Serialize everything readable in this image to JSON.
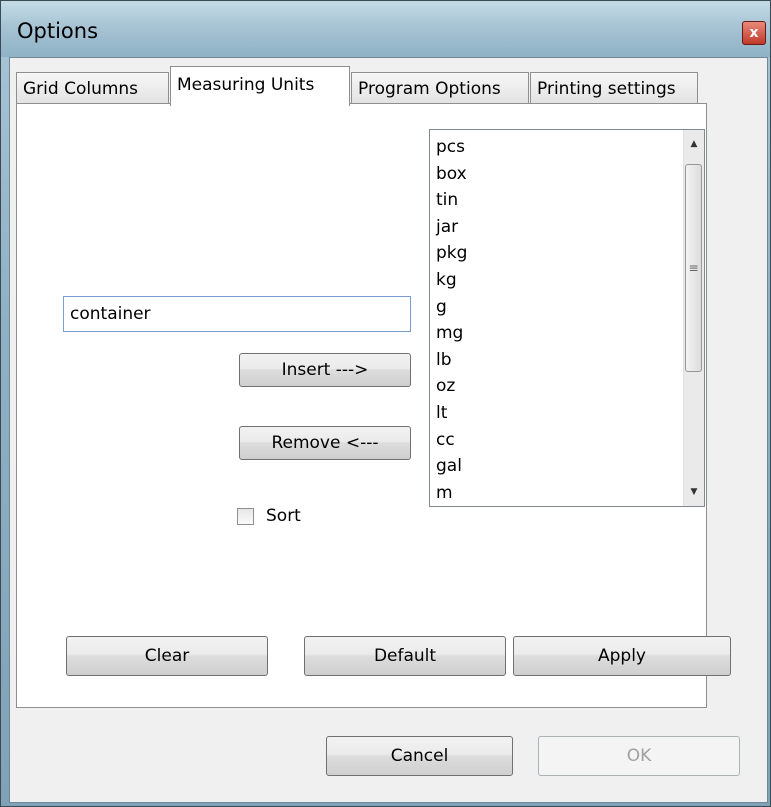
{
  "window": {
    "title": "Options",
    "close_glyph": "x"
  },
  "tabs": [
    {
      "label": "Grid Columns",
      "active": false
    },
    {
      "label": "Measuring Units",
      "active": true
    },
    {
      "label": "Program Options",
      "active": false
    },
    {
      "label": "Printing settings",
      "active": false
    }
  ],
  "units_panel": {
    "unit_input_value": "container",
    "insert_label": "Insert --->",
    "remove_label": "Remove <---",
    "sort_label": "Sort",
    "sort_checked": false,
    "unit_list": [
      "pcs",
      "box",
      "tin",
      "jar",
      "pkg",
      "kg",
      "g",
      "mg",
      "lb",
      "oz",
      "lt",
      "cc",
      "gal",
      "m"
    ],
    "clear_label": "Clear",
    "default_label": "Default",
    "apply_label": "Apply"
  },
  "footer": {
    "cancel_label": "Cancel",
    "ok_label": "OK",
    "ok_enabled": false
  },
  "icons": {
    "scroll_up": "scroll-up-arrow-icon",
    "scroll_down": "scroll-down-arrow-icon",
    "grip": "scroll-grip-icon"
  },
  "colors": {
    "title_bar": "#a7c4d4",
    "close_button": "#c0392b",
    "input_border": "#7a9cd3"
  }
}
